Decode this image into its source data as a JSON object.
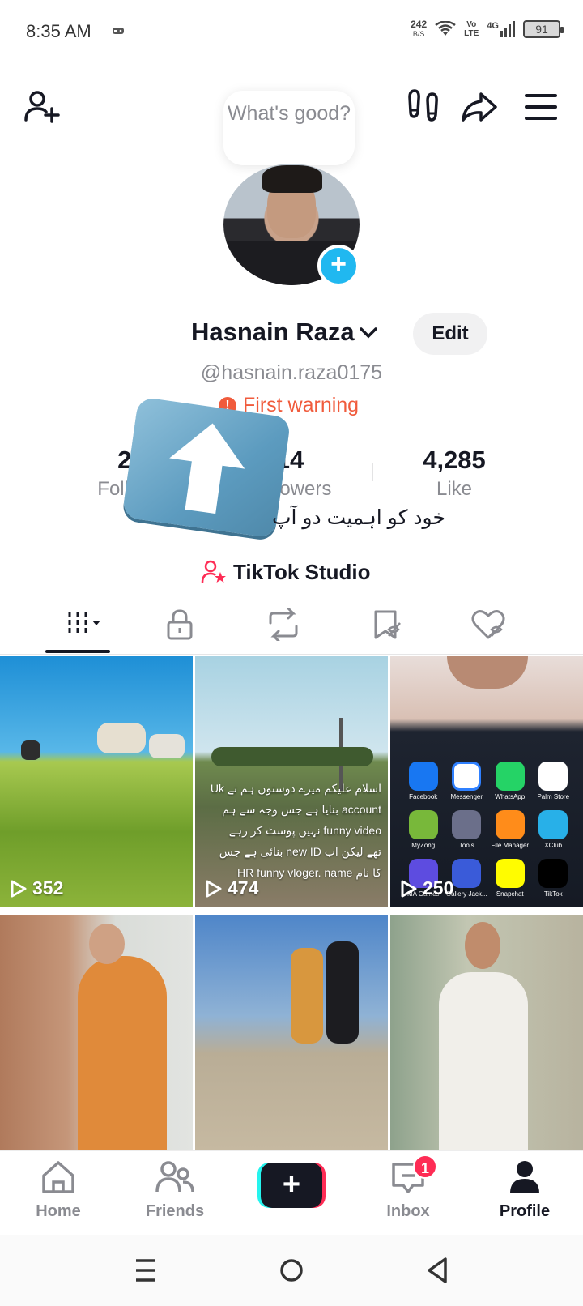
{
  "status_bar": {
    "time": "8:35 AM",
    "net_speed": "242",
    "net_unit": "B/S",
    "volte_top": "Vo",
    "volte_bottom": "LTE",
    "network": "4G",
    "battery": "91"
  },
  "profile": {
    "note": "What's good?",
    "display_name": "Hasnain Raza",
    "edit_label": "Edit",
    "username": "@hasnain.raza0175",
    "warning": "First warning",
    "bio": "خود کو اہمیت دو آپ",
    "studio_label": "TikTok Studio"
  },
  "stats": {
    "following_value": "238",
    "following_label": "Following",
    "followers_value": "14",
    "followers_label": "Followers",
    "likes_value": "4,285",
    "likes_label": "Like"
  },
  "tabs": [
    {
      "name": "videos",
      "icon": "grid-icon"
    },
    {
      "name": "private",
      "icon": "lock-icon"
    },
    {
      "name": "reposts",
      "icon": "repost-icon"
    },
    {
      "name": "favorites",
      "icon": "bookmark-icon"
    },
    {
      "name": "liked",
      "icon": "heart-icon"
    }
  ],
  "videos": [
    {
      "views": "352"
    },
    {
      "views": "474",
      "caption": [
        "اسلام علیکم میرے دوستوں ہم نے Uk",
        "account بنایا ہے جس وجہ سے ہم",
        "funny video نہیں پوسٹ کر رہے",
        "تھے لیکن اب new ID بنائی ہے جس",
        "کا نام HR funny vloger. name"
      ]
    },
    {
      "views": "250",
      "apps": [
        "Facebook",
        "Messenger",
        "WhatsApp",
        "Palm Store",
        "MyZong",
        "Tools",
        "File Manager",
        "XClub",
        "MA Games",
        "Gallery Jack...",
        "Snapchat",
        "TikTok"
      ]
    },
    {
      "views": ""
    },
    {
      "views": ""
    },
    {
      "views": ""
    }
  ],
  "bottom_nav": {
    "home": "Home",
    "friends": "Friends",
    "inbox": "Inbox",
    "inbox_badge": "1",
    "profile": "Profile"
  },
  "colors": {
    "accent": "#fe2c55",
    "cyan": "#25f4ee",
    "warning": "#f05b3c",
    "plus_blue": "#20b8f0"
  }
}
